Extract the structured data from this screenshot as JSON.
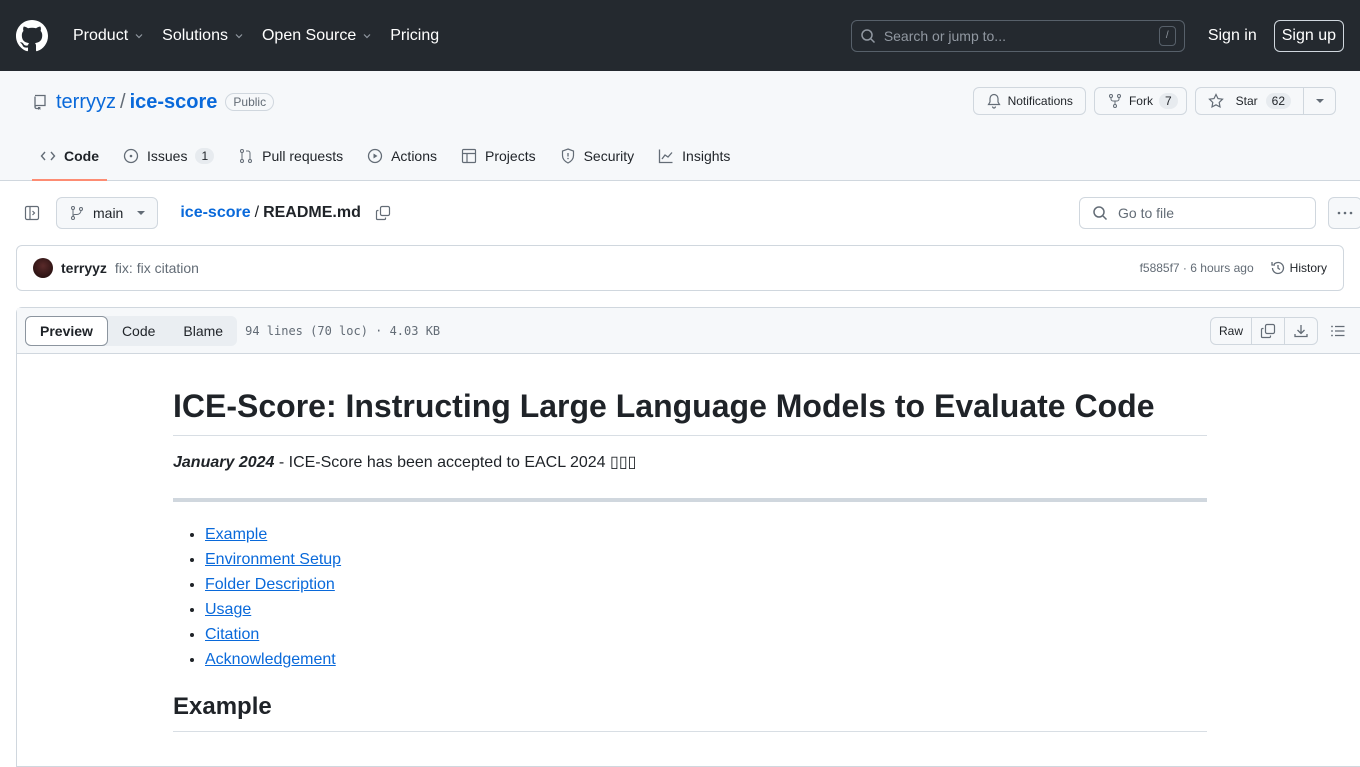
{
  "topnav": {
    "items": [
      {
        "label": "Product",
        "has_dropdown": true
      },
      {
        "label": "Solutions",
        "has_dropdown": true
      },
      {
        "label": "Open Source",
        "has_dropdown": true
      },
      {
        "label": "Pricing",
        "has_dropdown": false
      }
    ],
    "search_placeholder": "Search or jump to...",
    "search_shortcut": "/",
    "sign_in": "Sign in",
    "sign_up": "Sign up"
  },
  "repo": {
    "owner": "terryyz",
    "separator": "/",
    "name": "ice-score",
    "visibility": "Public",
    "notifications_label": "Notifications",
    "fork_label": "Fork",
    "fork_count": "7",
    "star_label": "Star",
    "star_count": "62"
  },
  "tabs": [
    {
      "label": "Code",
      "active": true
    },
    {
      "label": "Issues",
      "count": "1"
    },
    {
      "label": "Pull requests"
    },
    {
      "label": "Actions"
    },
    {
      "label": "Projects"
    },
    {
      "label": "Security"
    },
    {
      "label": "Insights"
    }
  ],
  "filebar": {
    "branch": "main",
    "crumb_repo": "ice-score",
    "crumb_sep": "/",
    "crumb_file": "README.md",
    "goto_placeholder": "Go to file"
  },
  "commit": {
    "author": "terryyz",
    "message": "fix: fix citation",
    "meta": "f5885f7 · 6 hours ago",
    "history_label": "History"
  },
  "fileview": {
    "modes": [
      "Preview",
      "Code",
      "Blame"
    ],
    "info": "94 lines (70 loc) · 4.03 KB",
    "raw_label": "Raw"
  },
  "readme": {
    "title": "ICE-Score: Instructing Large Language Models to Evaluate Code",
    "note_date": "January 2024",
    "note_text": " - ICE-Score has been accepted to EACL 2024 ▯▯▯",
    "toc": [
      "Example",
      "Environment Setup",
      "Folder Description",
      "Usage",
      "Citation",
      "Acknowledgement"
    ],
    "section_heading": "Example"
  }
}
